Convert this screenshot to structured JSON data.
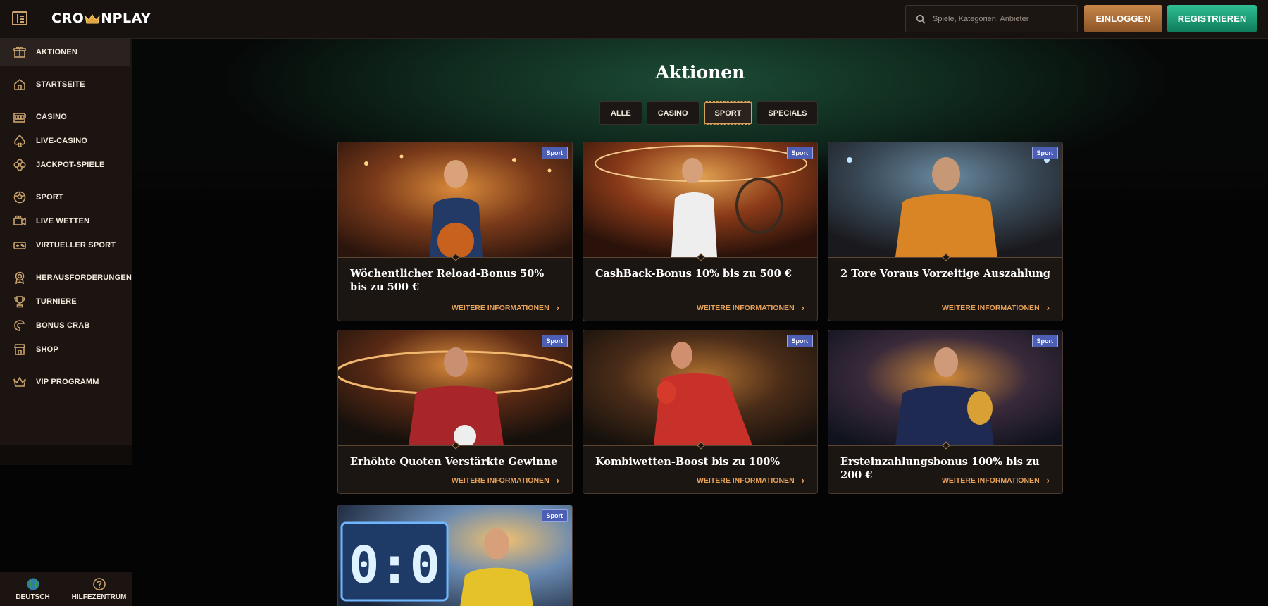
{
  "header": {
    "logo_text_left": "CRO",
    "logo_text_right": "NPLAY",
    "search_placeholder": "Spiele, Kategorien, Anbieter",
    "login_label": "EINLOGGEN",
    "register_label": "REGISTRIEREN"
  },
  "sidebar": {
    "items": [
      {
        "label": "AKTIONEN",
        "icon": "gift-icon"
      },
      {
        "label": "STARTSEITE",
        "icon": "home-icon"
      },
      {
        "label": "CASINO",
        "icon": "slot-machine-icon"
      },
      {
        "label": "LIVE-CASINO",
        "icon": "spade-icon"
      },
      {
        "label": "JACKPOT-SPIELE",
        "icon": "clover-icon"
      },
      {
        "label": "SPORT",
        "icon": "soccer-ball-icon"
      },
      {
        "label": "LIVE WETTEN",
        "icon": "live-camera-icon"
      },
      {
        "label": "VIRTUELLER SPORT",
        "icon": "gamepad-icon"
      },
      {
        "label": "HERAUSFORDERUNGEN",
        "icon": "medal-icon"
      },
      {
        "label": "TURNIERE",
        "icon": "trophy-icon"
      },
      {
        "label": "BONUS CRAB",
        "icon": "claw-icon"
      },
      {
        "label": "SHOP",
        "icon": "shop-icon"
      },
      {
        "label": "VIP PROGRAMM",
        "icon": "crown-icon"
      }
    ],
    "bottom": {
      "language_label": "DEUTSCH",
      "help_label": "HILFEZENTRUM"
    }
  },
  "main": {
    "title": "Aktionen",
    "tabs": [
      {
        "label": "ALLE",
        "active": false
      },
      {
        "label": "CASINO",
        "active": false
      },
      {
        "label": "SPORT",
        "active": true
      },
      {
        "label": "SPECIALS",
        "active": false
      }
    ],
    "cards": [
      {
        "badge": "Sport",
        "title": "Wöchentlicher Reload-Bonus 50% bis zu 500 €",
        "more": "WEITERE INFORMATIONEN"
      },
      {
        "badge": "Sport",
        "title": "CashBack-Bonus 10% bis zu 500 €",
        "more": "WEITERE INFORMATIONEN"
      },
      {
        "badge": "Sport",
        "title": "2 Tore Voraus Vorzeitige Auszahlung",
        "more": "WEITERE INFORMATIONEN"
      },
      {
        "badge": "Sport",
        "title": "Erhöhte Quoten Verstärkte Gewinne",
        "more": "WEITERE INFORMATIONEN"
      },
      {
        "badge": "Sport",
        "title": "Kombiwetten-Boost bis zu 100%",
        "more": "WEITERE INFORMATIONEN"
      },
      {
        "badge": "Sport",
        "title": "Ersteinzahlungsbonus 100% bis zu 200 €",
        "more": "WEITERE INFORMATIONEN"
      },
      {
        "badge": "Sport",
        "title": "",
        "more": ""
      }
    ],
    "card7_scoreboard": "0:0"
  },
  "colors": {
    "accent_gold": "#c9a36d",
    "login_orange": "#c9874a",
    "register_green": "#2fbf93",
    "badge_blue": "#4d5fb5",
    "link_orange": "#e7a25a"
  }
}
